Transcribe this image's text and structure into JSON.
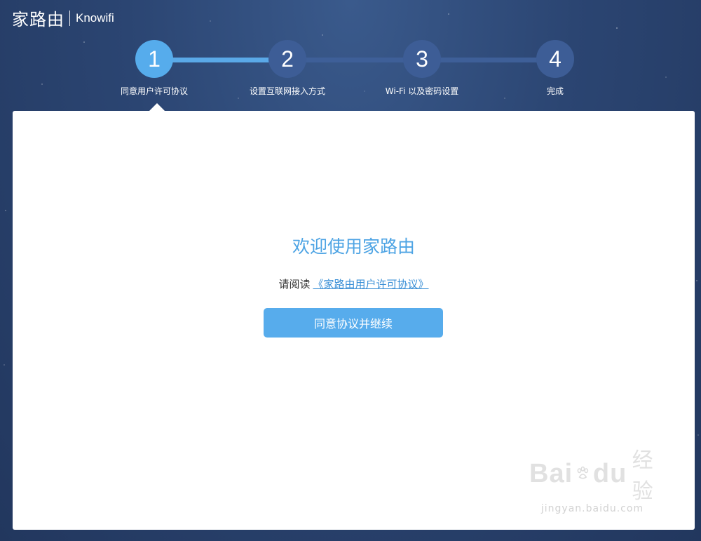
{
  "brand": {
    "name_cn": "家路由",
    "name_en": "Knowifi"
  },
  "steps": [
    {
      "number": "1",
      "label": "同意用户许可协议",
      "active": true
    },
    {
      "number": "2",
      "label": "设置互联网接入方式",
      "active": false
    },
    {
      "number": "3",
      "label": "Wi-Fi 以及密码设置",
      "active": false
    },
    {
      "number": "4",
      "label": "完成",
      "active": false
    }
  ],
  "panel": {
    "welcome_title": "欢迎使用家路由",
    "read_prefix": "请阅读",
    "agreement_link": "《家路由用户许可协议》",
    "agree_button": "同意协议并继续"
  },
  "watermark": {
    "logo_text": "Bai",
    "logo_text2": "du",
    "logo_cn": "经验",
    "url": "jingyan.baidu.com"
  },
  "colors": {
    "accent": "#56acec",
    "inactive": "#3d5d96",
    "background": "#2b4572",
    "link": "#3a8fd6"
  }
}
